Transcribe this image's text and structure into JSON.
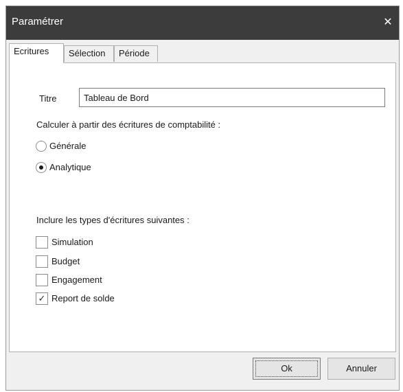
{
  "dialog": {
    "title": "Paramétrer",
    "close_glyph": "✕"
  },
  "tabs": [
    {
      "label": "Ecritures",
      "active": true
    },
    {
      "label": "Sélection",
      "active": false
    },
    {
      "label": "Période",
      "active": false
    }
  ],
  "titre": {
    "label": "Titre",
    "value": "Tableau de Bord"
  },
  "calcul": {
    "heading": "Calculer à partir des écritures de comptabilité :",
    "options": [
      {
        "label": "Générale",
        "selected": false
      },
      {
        "label": "Analytique",
        "selected": true
      }
    ]
  },
  "types": {
    "heading": "Inclure les types d'écritures suivantes :",
    "items": [
      {
        "label": "Simulation",
        "checked": false
      },
      {
        "label": "Budget",
        "checked": false
      },
      {
        "label": "Engagement",
        "checked": false
      },
      {
        "label": "Report de solde",
        "checked": true
      }
    ]
  },
  "buttons": {
    "ok": "Ok",
    "cancel": "Annuler"
  },
  "icons": {
    "close": "close-icon",
    "checkmark": "checkmark-icon",
    "radio_dot": "radio-dot-icon"
  },
  "colors": {
    "titlebar": "#3c3c3c",
    "panel": "#ffffff",
    "dialog_bg": "#f0f0f0"
  }
}
